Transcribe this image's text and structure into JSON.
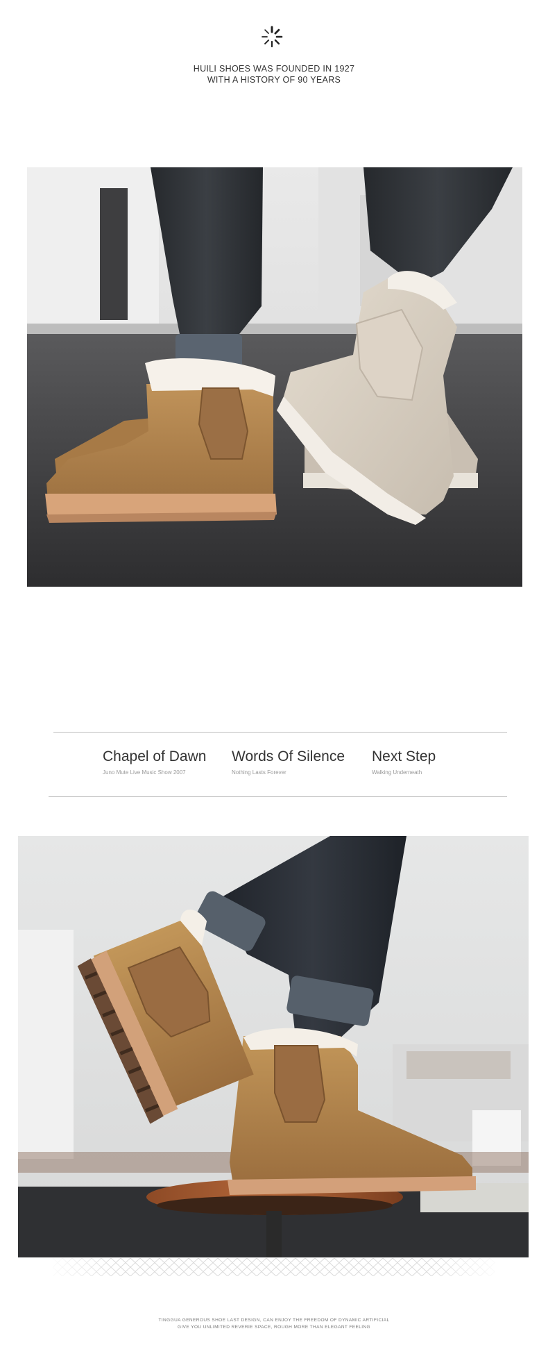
{
  "header": {
    "logo_icon": "loading-spinner-icon",
    "line1": "HUILI SHOES WAS FOUNDED IN 1927",
    "line2": "WITH A HISTORY OF 90 YEARS"
  },
  "photos": [
    {
      "subject": "couple-wearing-chestnut-and-grey-snow-boots"
    },
    {
      "subject": "chestnut-snow-boots-on-wooden-stool"
    }
  ],
  "series": [
    {
      "title": "Chapel of Dawn",
      "subtitle": "Juno Mute Live Music Show 2007"
    },
    {
      "title": "Words Of Silence",
      "subtitle": "Nothing Lasts Forever"
    },
    {
      "title": "Next Step",
      "subtitle": "Walking Underneath"
    }
  ],
  "footer": {
    "line1": "TINGGUA GENEROUS SHOE LAST DESIGN, CAN ENJOY THE FREEDOM OF DYNAMIC ARTIFICIAL",
    "line2": "GIVE YOU UNLIMITED REVERIE SPACE, ROUGH MORE THAN ELEGANT FEELING"
  },
  "colors": {
    "chestnut": "#b4874f",
    "grey_boot": "#d8d0c4",
    "denim": "#2f3236",
    "asphalt": "#3a3a3c",
    "rule": "#bdbdbd"
  }
}
